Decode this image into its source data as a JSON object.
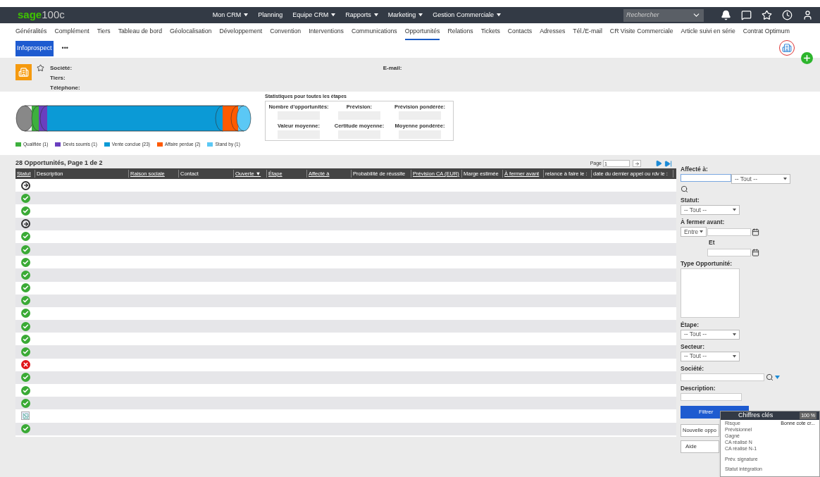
{
  "topbar": {
    "logo": "sage",
    "logo_suffix": "100c",
    "menu": [
      {
        "label": "Mon CRM",
        "dropdown": true
      },
      {
        "label": "Planning",
        "dropdown": false
      },
      {
        "label": "Equipe CRM",
        "dropdown": true
      },
      {
        "label": "Rapports",
        "dropdown": true
      },
      {
        "label": "Marketing",
        "dropdown": true
      },
      {
        "label": "Gestion Commerciale",
        "dropdown": true
      }
    ],
    "search": {
      "placeholder": "Rechercher"
    }
  },
  "tabs": [
    {
      "label": "Généralités",
      "selected": false
    },
    {
      "label": "Complément",
      "selected": false
    },
    {
      "label": "Tiers",
      "selected": false
    },
    {
      "label": "Tableau de bord",
      "selected": false
    },
    {
      "label": "Géolocalisation",
      "selected": false
    },
    {
      "label": "Développement",
      "selected": false
    },
    {
      "label": "Convention",
      "selected": false
    },
    {
      "label": "Interventions",
      "selected": false
    },
    {
      "label": "Communications",
      "selected": false
    },
    {
      "label": "Opportunités",
      "selected": true
    },
    {
      "label": "Relations",
      "selected": false
    },
    {
      "label": "Tickets",
      "selected": false
    },
    {
      "label": "Contacts",
      "selected": false
    },
    {
      "label": "Adresses",
      "selected": false
    },
    {
      "label": "Tél./E-mail",
      "selected": false
    },
    {
      "label": "CR Visite Commerciale",
      "selected": false
    },
    {
      "label": "Article suivi en série",
      "selected": false
    },
    {
      "label": "Contrat Optimum",
      "selected": false
    }
  ],
  "subtabs": [
    {
      "label": "Infoprospect",
      "selected": true
    },
    {
      "label": "•••",
      "selected": false
    }
  ],
  "header": {
    "fields_left": [
      "Société:",
      "Tiers:",
      "Téléphone:"
    ],
    "field_right": "E-mail:"
  },
  "chart": {
    "legend": [
      {
        "label": "Qualifiée (1)",
        "color": "#3db03d"
      },
      {
        "label": "Devis soumis (1)",
        "color": "#6a3fbf"
      },
      {
        "label": "Vente conclue (23)",
        "color": "#0b9ad6"
      },
      {
        "label": "Affaire perdue (2)",
        "color": "#ff5a00"
      },
      {
        "label": "Stand by (1)",
        "color": "#5bc8f5"
      }
    ]
  },
  "stats": {
    "title": "Statistiques pour toutes les étapes",
    "items": [
      "Nombre d'opportunités:",
      "Prévision:",
      "Prévision pondérée:",
      "Valeur moyenne:",
      "Certitude moyenne:",
      "Moyenne pondérée:"
    ]
  },
  "table": {
    "summary": "28 Opportunités, Page 1 de 2",
    "page_label": "Page",
    "page_value": "1",
    "columns": [
      {
        "label": "Statut",
        "link": true
      },
      {
        "label": "Description",
        "link": false
      },
      {
        "label": "Raison sociale",
        "link": true
      },
      {
        "label": "Contact",
        "link": false
      },
      {
        "label": "Ouverte ▼",
        "link": true
      },
      {
        "label": "Étape",
        "link": true
      },
      {
        "label": "Affecté à",
        "link": true
      },
      {
        "label": "Probabilité de réussite",
        "link": false
      },
      {
        "label": "Prévision CA (EUR)",
        "link": true
      },
      {
        "label": "Marge estimée",
        "link": false
      },
      {
        "label": "À fermer avant",
        "link": true
      },
      {
        "label": "relance à faire le :",
        "link": false
      },
      {
        "label": "date du dernier appel ou rdv le :",
        "link": false
      }
    ],
    "rows": [
      {
        "kind": "arrow"
      },
      {
        "kind": "ok"
      },
      {
        "kind": "ok"
      },
      {
        "kind": "arrow"
      },
      {
        "kind": "ok"
      },
      {
        "kind": "ok"
      },
      {
        "kind": "ok"
      },
      {
        "kind": "ok"
      },
      {
        "kind": "ok"
      },
      {
        "kind": "ok"
      },
      {
        "kind": "ok"
      },
      {
        "kind": "ok"
      },
      {
        "kind": "ok"
      },
      {
        "kind": "ok"
      },
      {
        "kind": "error"
      },
      {
        "kind": "ok"
      },
      {
        "kind": "ok"
      },
      {
        "kind": "ok"
      },
      {
        "kind": "broken"
      },
      {
        "kind": "ok"
      }
    ]
  },
  "filters": {
    "affecte_label": "Affecté à:",
    "affecte_select": "-- Tout --",
    "statut_label": "Statut:",
    "statut_select": "-- Tout --",
    "fermer_label": "À fermer avant:",
    "fermer_select": "Entre",
    "et_label": "Et",
    "type_label": "Type Opportunité:",
    "etape_label": "Étape:",
    "etape_select": "-- Tout --",
    "secteur_label": "Secteur:",
    "secteur_select": "-- Tout --",
    "societe_label": "Société:",
    "description_label": "Description:",
    "filter_button": "Filtrer",
    "new_button": "Nouvelle oppo",
    "help_button": "Aide"
  },
  "popup": {
    "title": "Chiffres clés",
    "zoom": "100 %",
    "rows": [
      {
        "label": "Risque",
        "value": "Bonne cote cr..."
      },
      {
        "label": "Prévisionnel"
      },
      {
        "label": "Gagné"
      },
      {
        "label": "CA réalisé N"
      },
      {
        "label": "CA réalisé N-1"
      },
      {
        "label": "Prév. signature"
      },
      {
        "label": "Statut intégration"
      }
    ]
  }
}
